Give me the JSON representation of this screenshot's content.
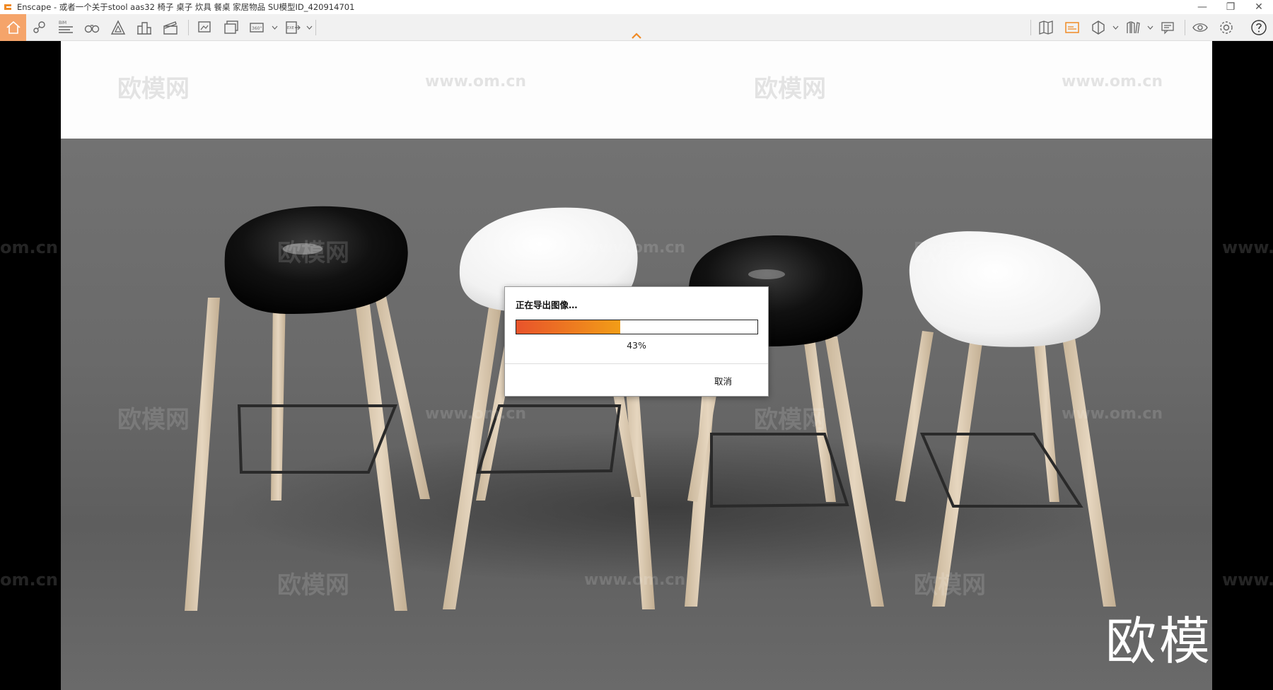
{
  "window": {
    "title": "Enscape - 或者一个关于stool aas32 椅子 桌子 炊具 餐桌 家居物品 SU模型ID_420914701",
    "minimize": "—",
    "restore": "❐",
    "close": "✕"
  },
  "toolbar": {
    "bim_label": "BIM",
    "pano_label": "360°",
    "exe_label": "EXE"
  },
  "viewport": {
    "watermark_cn": "欧模网",
    "watermark_url": "www.om.cn",
    "watermark_url_short": "om.cn",
    "watermark_url_partial": "www.",
    "brand_logo": "欧模网"
  },
  "dialog": {
    "title": "正在导出图像…",
    "progress_value": 0.43,
    "progress_text": "43%",
    "cancel_label": "取消"
  },
  "colors": {
    "accent": "#f5a46a",
    "progress_start": "#e8532b",
    "progress_end": "#f29d17"
  }
}
